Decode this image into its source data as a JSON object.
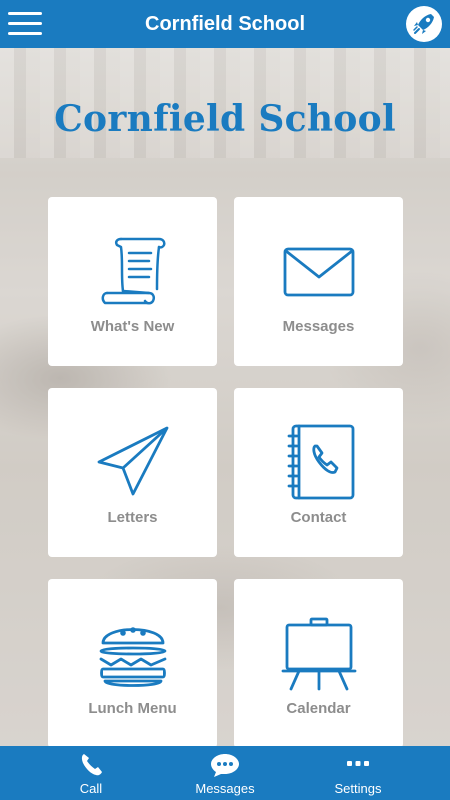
{
  "header": {
    "title": "Cornfield School",
    "menu_icon": "hamburger-menu-icon",
    "action_icon": "rocket-icon"
  },
  "banner": {
    "school_name": "Cornfield School"
  },
  "tiles": [
    {
      "label": "What's New",
      "icon": "scroll-icon"
    },
    {
      "label": "Messages",
      "icon": "envelope-icon"
    },
    {
      "label": "Letters",
      "icon": "paper-plane-icon"
    },
    {
      "label": "Contact",
      "icon": "phone-book-icon"
    },
    {
      "label": "Lunch Menu",
      "icon": "burger-icon"
    },
    {
      "label": "Calendar",
      "icon": "easel-board-icon"
    }
  ],
  "bottom_nav": [
    {
      "label": "Call",
      "icon": "phone-icon"
    },
    {
      "label": "Messages",
      "icon": "chat-bubble-icon"
    },
    {
      "label": "Settings",
      "icon": "more-dots-icon"
    }
  ],
  "colors": {
    "brand": "#1a7bc0",
    "tile_label": "#8d8d8d",
    "tile_bg": "#ffffff"
  }
}
